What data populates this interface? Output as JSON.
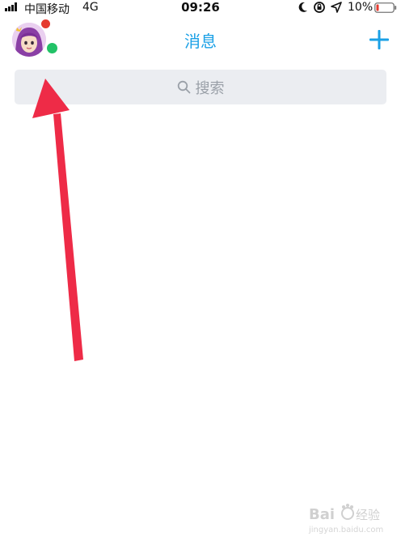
{
  "status_bar": {
    "carrier": "中国移动",
    "network": "4G",
    "time": "09:26",
    "battery_percent": "10%"
  },
  "nav": {
    "title": "消息",
    "add_icon": "plus-icon"
  },
  "search": {
    "placeholder": "搜索",
    "icon": "search-icon"
  },
  "watermark": {
    "brand": "Bai du 经验",
    "url": "jingyan.baidu.com"
  },
  "colors": {
    "accent": "#1aa0e6",
    "arrow": "#ee2b47",
    "search_bg": "#ebedf1",
    "badge_red": "#e53a2f",
    "presence_green": "#22c267",
    "battery_low": "#e53a2f"
  }
}
